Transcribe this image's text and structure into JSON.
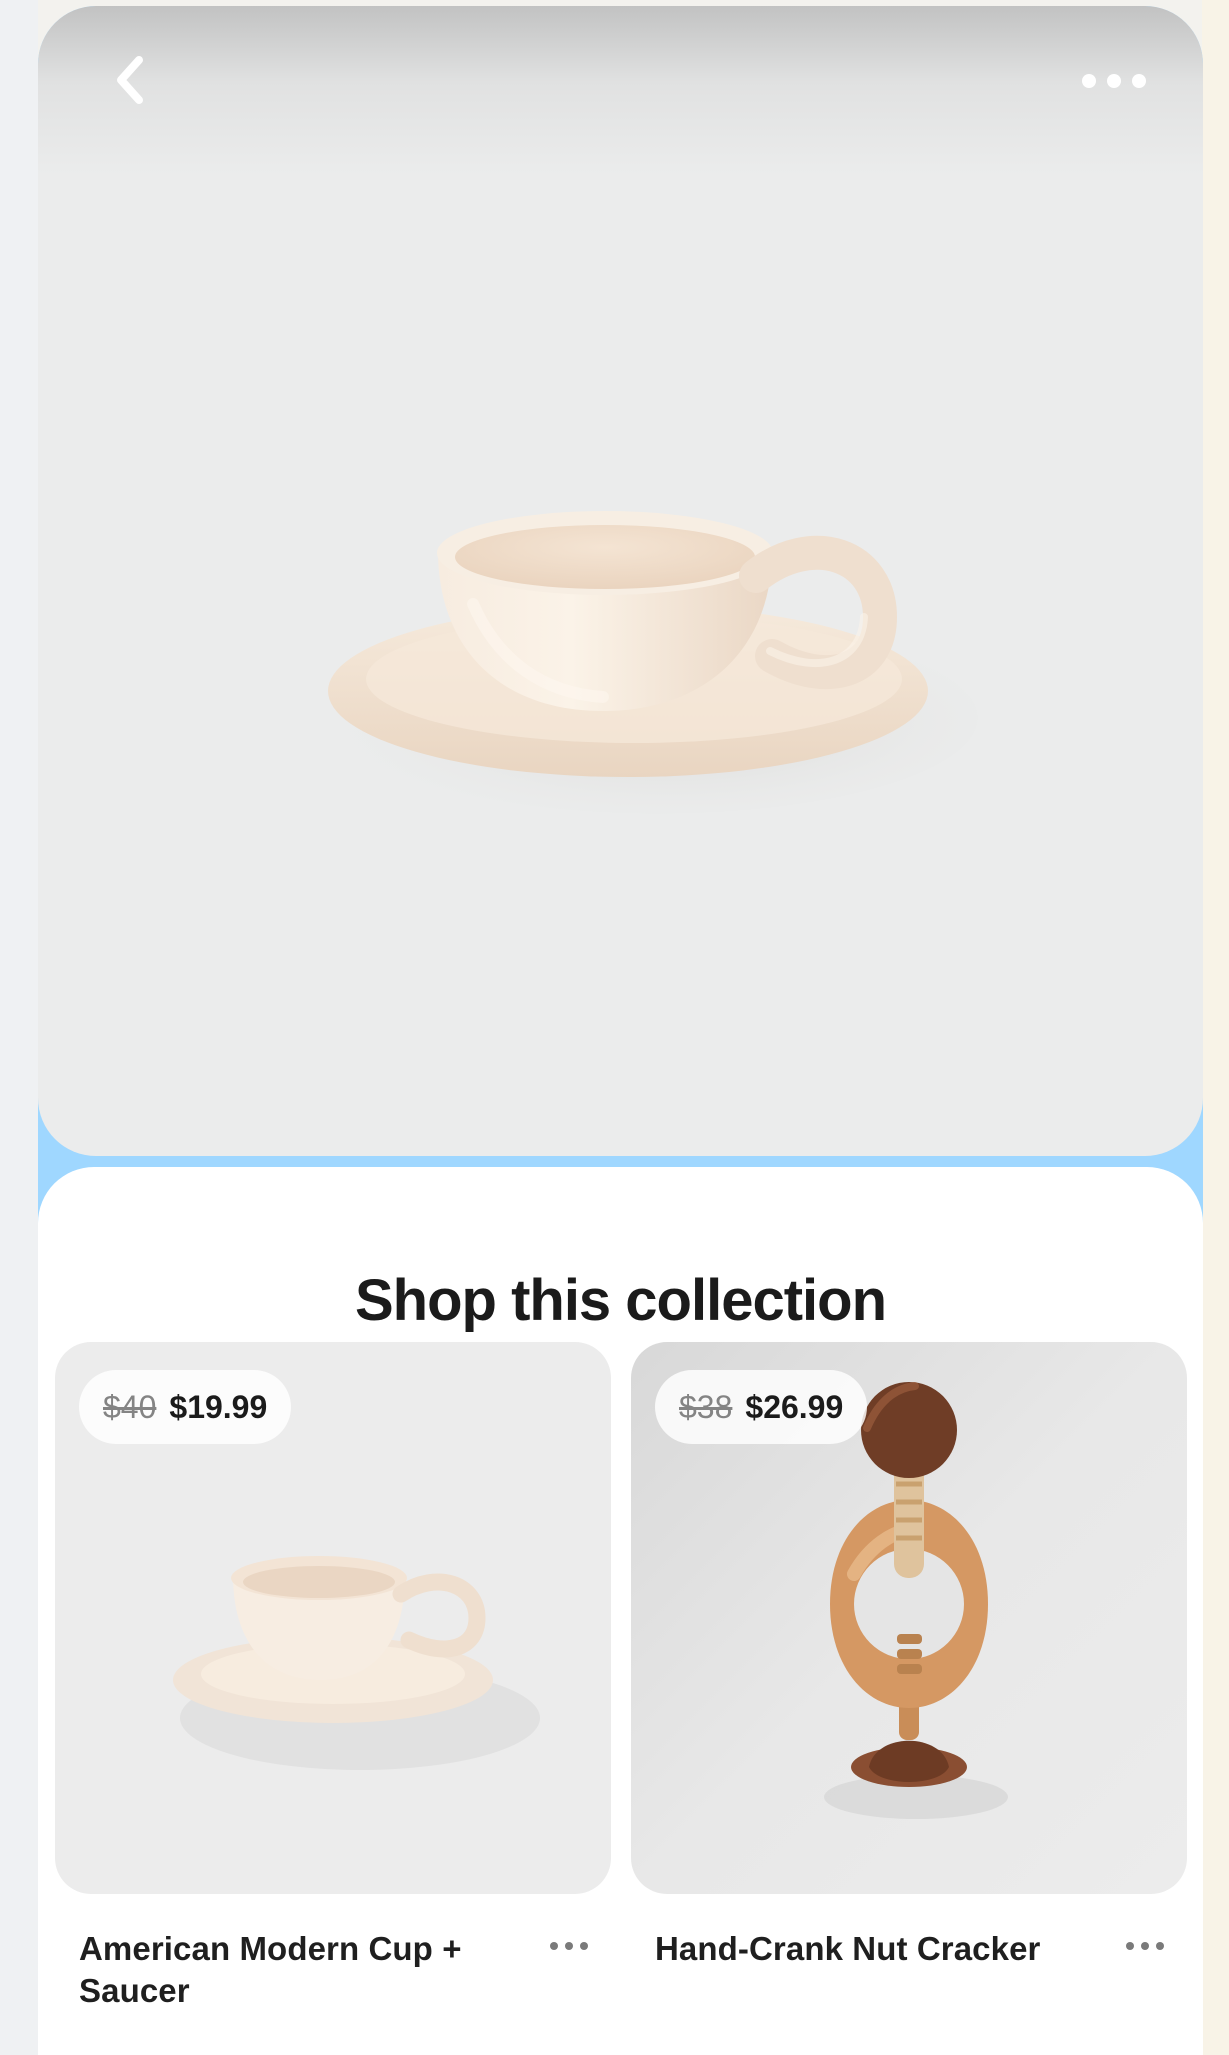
{
  "hero": {
    "back_icon": "chevron-left-icon",
    "more_icon": "more-horizontal-icon"
  },
  "sheet": {
    "title": "Shop this collection"
  },
  "products": [
    {
      "original_price": "$40",
      "sale_price": "$19.99",
      "name": "American Modern Cup + Saucer",
      "more_icon": "more-horizontal-icon"
    },
    {
      "original_price": "$38",
      "sale_price": "$26.99",
      "name": "Hand-Crank Nut Cracker",
      "more_icon": "more-horizontal-icon"
    }
  ],
  "colors": {
    "top_border": "#9fd7ff",
    "sheet_background": "#ffffff",
    "hero_background": "#ebecec",
    "text_primary": "#1b1b1b",
    "text_secondary": "#848484"
  }
}
